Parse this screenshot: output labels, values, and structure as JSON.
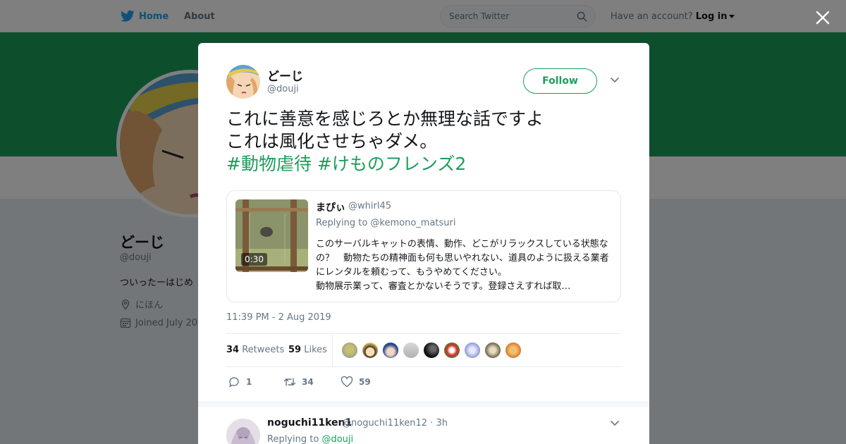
{
  "topbar": {
    "home_label": "Home",
    "about_label": "About",
    "search_placeholder": "Search Twitter",
    "have_account": "Have an account?",
    "login_label": "Log in"
  },
  "profile": {
    "name": "どーじ",
    "handle": "@douji",
    "bio": "ついったーはじめ",
    "location": "にほん",
    "joined": "Joined July 20",
    "banner_color": "#1b9e5b"
  },
  "tweet": {
    "author_name": "どーじ",
    "author_handle": "@douji",
    "follow_label": "Follow",
    "text_line1": "これに善意を感じろとか無理な話ですよ",
    "text_line2": "これは風化させちゃダメ。",
    "hashtags": "#動物虐待 #けものフレンズ2",
    "timestamp": "11:39 PM - 2 Aug 2019",
    "retweets_count": "34",
    "retweets_label": "Retweets",
    "likes_count": "59",
    "likes_label": "Likes",
    "actions": {
      "reply": "1",
      "retweet": "34",
      "like": "59"
    },
    "accent_color": "#1b9e5b"
  },
  "quoted": {
    "name": "まぴぃ",
    "handle": "@whirl45",
    "replying_to": "Replying to @kemono_matsuri",
    "duration": "0:30",
    "text": "このサーバルキャットの表情、動作、どこがリラックスしている状態なの？　動物たちの精神面も何も思いやれない、道具のように扱える業者にレンタルを頼むって、もうやめてください。\n動物展示業って、審査とかないそうです。登録さえすれば取…"
  },
  "reply": {
    "name": "noguchi11ken1",
    "handle": "@noguchi11ken12 · 3h",
    "replying_prefix": "Replying to",
    "replying_handle": "@douji"
  }
}
